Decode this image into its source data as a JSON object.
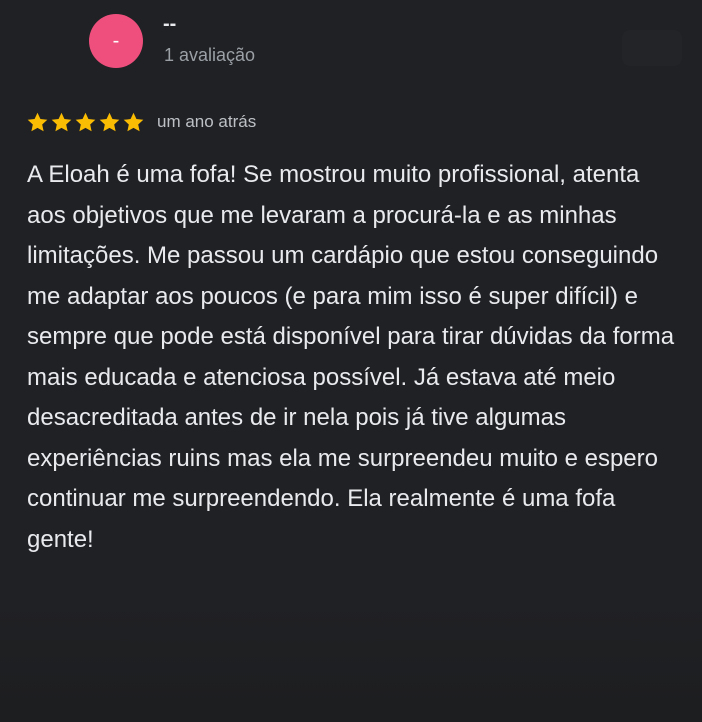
{
  "reviewer": {
    "avatar_letter": "-",
    "avatar_color": "#ee4f7d",
    "name": "--",
    "review_count": "1 avaliação"
  },
  "rating": {
    "stars": 5,
    "max_stars": 5,
    "star_color": "#fbbc04",
    "time_ago": "um ano atrás"
  },
  "review": {
    "text": "A Eloah é uma fofa! Se mostrou muito profissional, atenta aos objetivos que me levaram a procurá-la e as minhas limitações. Me passou um cardápio que estou conseguindo me adaptar aos poucos (e para mim isso é super difícil) e sempre que pode está disponível para tirar dúvidas da forma mais educada e atenciosa possível. Já estava até meio desacreditada antes de ir nela pois já tive algumas experiências ruins mas ela me surpreendeu muito e espero continuar me surpreendendo. Ela realmente é uma fofa gente!"
  },
  "icons": {
    "star": "star-icon"
  }
}
